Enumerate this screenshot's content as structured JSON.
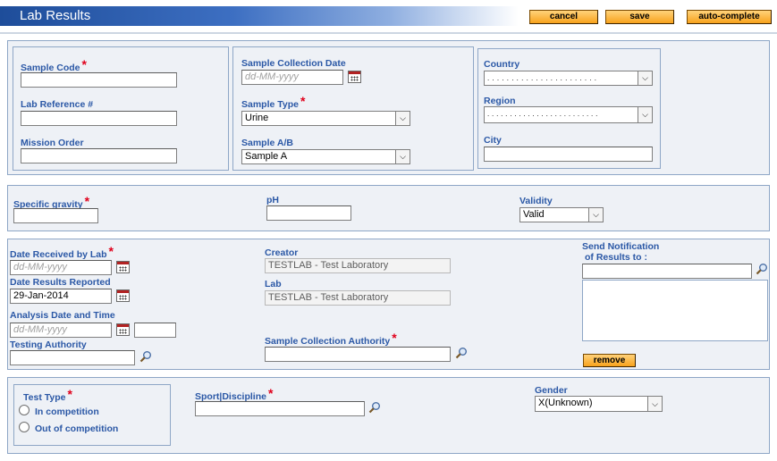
{
  "header": {
    "title": "Lab Results",
    "cancel_label": "cancel",
    "save_label": "save",
    "autocomplete_label": "auto-complete"
  },
  "sample": {
    "sample_code_label": "Sample Code",
    "sample_code_value": "",
    "lab_reference_label": "Lab Reference #",
    "lab_reference_value": "",
    "mission_order_label": "Mission Order",
    "mission_order_value": "",
    "collection_date_label": "Sample Collection Date",
    "collection_date_placeholder": "dd-MM-yyyy",
    "sample_type_label": "Sample Type",
    "sample_type_value": "Urine",
    "sample_ab_label": "Sample A/B",
    "sample_ab_value": "Sample A",
    "country_label": "Country",
    "country_value": ". . . . . . . . . . . . . . . . . . . . . . .",
    "region_label": "Region",
    "region_value": ". . . . . . . . . . . . . . . . . . . . . . . . .",
    "city_label": "City",
    "city_value": ""
  },
  "measurements": {
    "specific_gravity_label": "Specific gravity",
    "specific_gravity_value": "",
    "ph_label": "pH",
    "ph_value": "",
    "validity_label": "Validity",
    "validity_value": "Valid"
  },
  "processing": {
    "date_received_label": "Date Received by Lab",
    "date_received_placeholder": "dd-MM-yyyy",
    "date_reported_label": "Date Results Reported",
    "date_reported_value": "29-Jan-2014",
    "analysis_date_label": "Analysis Date and Time",
    "analysis_date_placeholder": "dd-MM-yyyy",
    "analysis_time_value": "",
    "testing_authority_label": "Testing Authority",
    "testing_authority_value": "",
    "creator_label": "Creator",
    "creator_value": "TESTLAB - Test Laboratory",
    "lab_label": "Lab",
    "lab_value": "TESTLAB - Test Laboratory",
    "collection_authority_label": "Sample Collection Authority",
    "collection_authority_value": "",
    "notify_label_line1": "Send Notification",
    "notify_label_line2": "of Results to :",
    "notify_input_value": "",
    "remove_label": "remove"
  },
  "athlete": {
    "test_type_label": "Test Type",
    "in_competition_label": "In competition",
    "out_of_competition_label": "Out of competition",
    "sport_label": "Sport|Discipline",
    "sport_value": "",
    "gender_label": "Gender",
    "gender_value": "X(Unknown)"
  },
  "colors": {
    "label_blue": "#2b58a6",
    "required_red": "#e0001b",
    "button_orange": "#f8a21c",
    "panel_bg": "#eef1f6"
  }
}
